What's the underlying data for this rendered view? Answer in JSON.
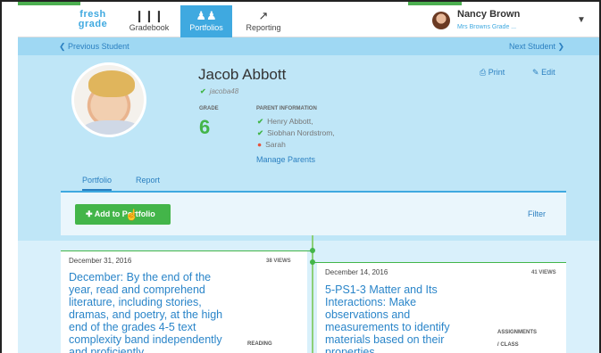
{
  "nav": {
    "logo_line1": "fresh",
    "logo_line2": "grade",
    "items": [
      {
        "label": "Gradebook",
        "icon": "gradebook-icon",
        "glyph": "❙❙❙"
      },
      {
        "label": "Portfolios",
        "icon": "portfolios-icon",
        "glyph": "♟♟"
      },
      {
        "label": "Reporting",
        "icon": "reporting-icon",
        "glyph": "↗"
      }
    ],
    "user_name": "Nancy Brown",
    "user_sub": "Mrs Browns Grade ..."
  },
  "student_nav": {
    "previous": "Previous Student",
    "next": "Next Student"
  },
  "student": {
    "name": "Jacob Abbott",
    "username": "jacoba48",
    "grade_label": "GRADE",
    "grade": "6",
    "parent_label": "PARENT INFORMATION",
    "parents": [
      "Henry Abbott,",
      "Siobhan Nordstrom,",
      "Sarah"
    ],
    "manage_parents": "Manage Parents"
  },
  "actions": {
    "print": "Print",
    "edit": "Edit"
  },
  "tabs": [
    {
      "label": "Portfolio"
    },
    {
      "label": "Report"
    }
  ],
  "toolbar": {
    "add": "Add to Portfolio",
    "filter": "Filter"
  },
  "cards": [
    {
      "date": "December 31, 2016",
      "views": "38 VIEWS",
      "title_lines": [
        "December: By the end of the",
        "year, read and comprehend",
        "literature, including stories,",
        "dramas, and poetry, at the high",
        "end of the grades 4-5 text",
        "complexity band independently",
        "and proficiently."
      ],
      "meta": "READING"
    },
    {
      "date": "December 14, 2016",
      "views": "41 VIEWS",
      "title_lines": [
        "5-PS1-3 Matter and Its",
        "Interactions: Make",
        "observations and",
        "measurements to identify",
        "materials based on their",
        "properties."
      ],
      "meta_lines": [
        "ASSIGNMENTS",
        "/ CLASS"
      ]
    }
  ],
  "colors": {
    "accent": "#3fa9e0",
    "green": "#43b549",
    "link": "#2a7fc0"
  }
}
